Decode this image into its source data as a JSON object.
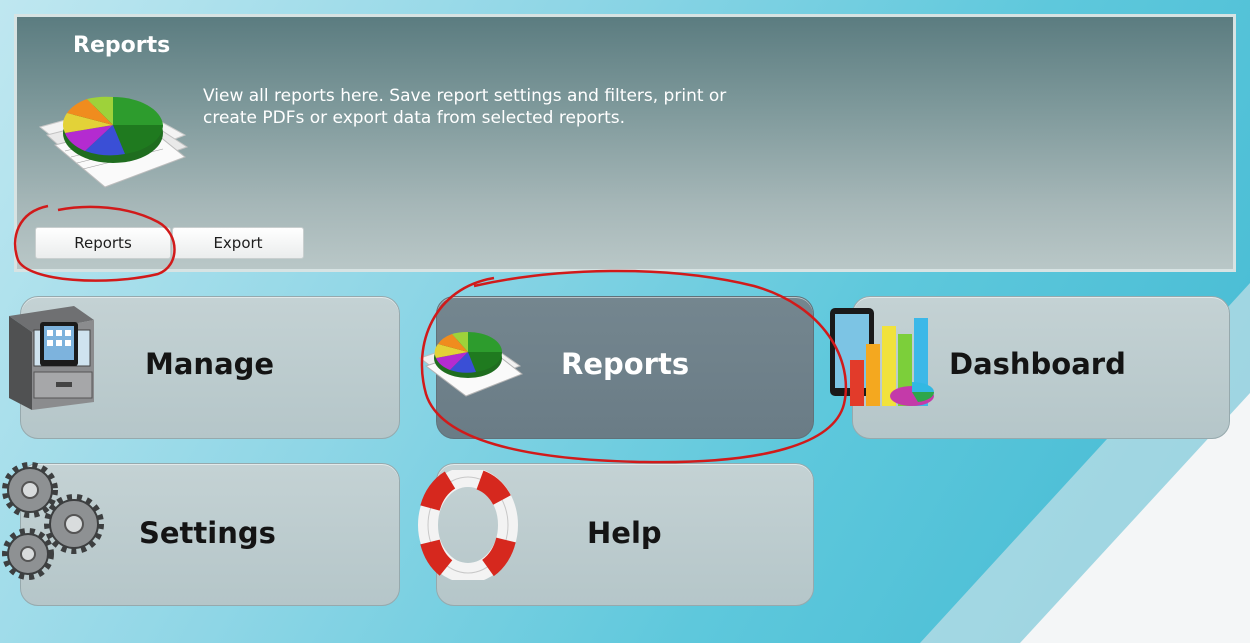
{
  "header": {
    "title": "Reports",
    "description_line1": "View all reports here. Save report settings and filters, print or",
    "description_line2": "create PDFs or export data from selected reports.",
    "tabs": [
      {
        "label": "Reports"
      },
      {
        "label": "Export"
      }
    ]
  },
  "tiles": {
    "manage": {
      "label": "Manage",
      "icon": "file-cabinet-icon"
    },
    "reports": {
      "label": "Reports",
      "icon": "pie-chart-icon",
      "active": true
    },
    "dashboard": {
      "label": "Dashboard",
      "icon": "bar-chart-icon"
    },
    "settings": {
      "label": "Settings",
      "icon": "gears-icon"
    },
    "help": {
      "label": "Help",
      "icon": "lifebuoy-icon"
    }
  },
  "colors": {
    "panel_top": "#5b7c80",
    "tile_bg": "#c4d2d4",
    "tile_active_bg": "#74868f",
    "annotation": "#d11a1a"
  }
}
